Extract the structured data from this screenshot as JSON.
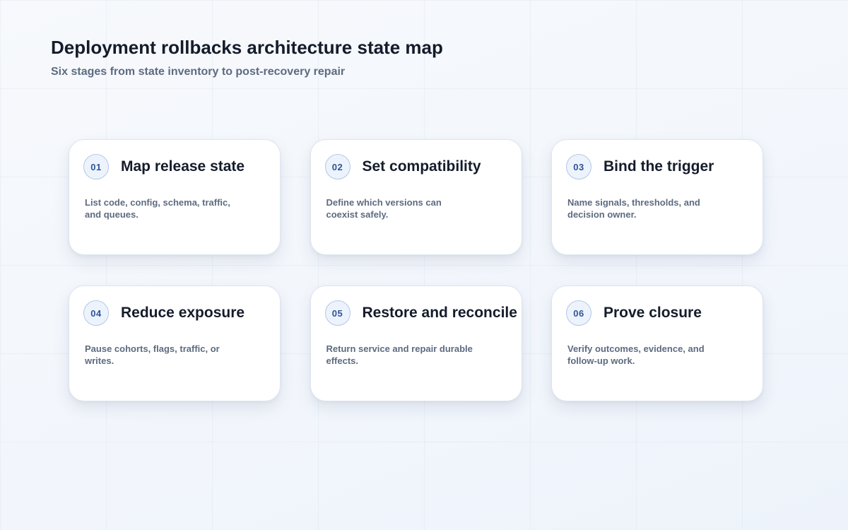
{
  "header": {
    "title": "Deployment rollbacks architecture state map",
    "subtitle": "Six stages from state inventory to post-recovery repair"
  },
  "stages": [
    {
      "number": "01",
      "title": "Map release state",
      "description": "List code, config, schema, traffic, and queues."
    },
    {
      "number": "02",
      "title": "Set compatibility",
      "description": "Define which versions can coexist safely."
    },
    {
      "number": "03",
      "title": "Bind the trigger",
      "description": "Name signals, thresholds, and decision owner."
    },
    {
      "number": "04",
      "title": "Reduce exposure",
      "description": "Pause cohorts, flags, traffic, or writes."
    },
    {
      "number": "05",
      "title": "Restore and reconcile",
      "description": "Return service and repair durable effects."
    },
    {
      "number": "06",
      "title": "Prove closure",
      "description": "Verify outcomes, evidence, and follow-up work."
    }
  ],
  "colors": {
    "accent": "#2f5597",
    "title_text": "#141c2b",
    "muted_text": "#5d6b80",
    "badge_fill": "#edf3fc",
    "badge_border": "#b3c8e6",
    "card_border": "#dde5f0",
    "background": "#f5f8fd"
  }
}
